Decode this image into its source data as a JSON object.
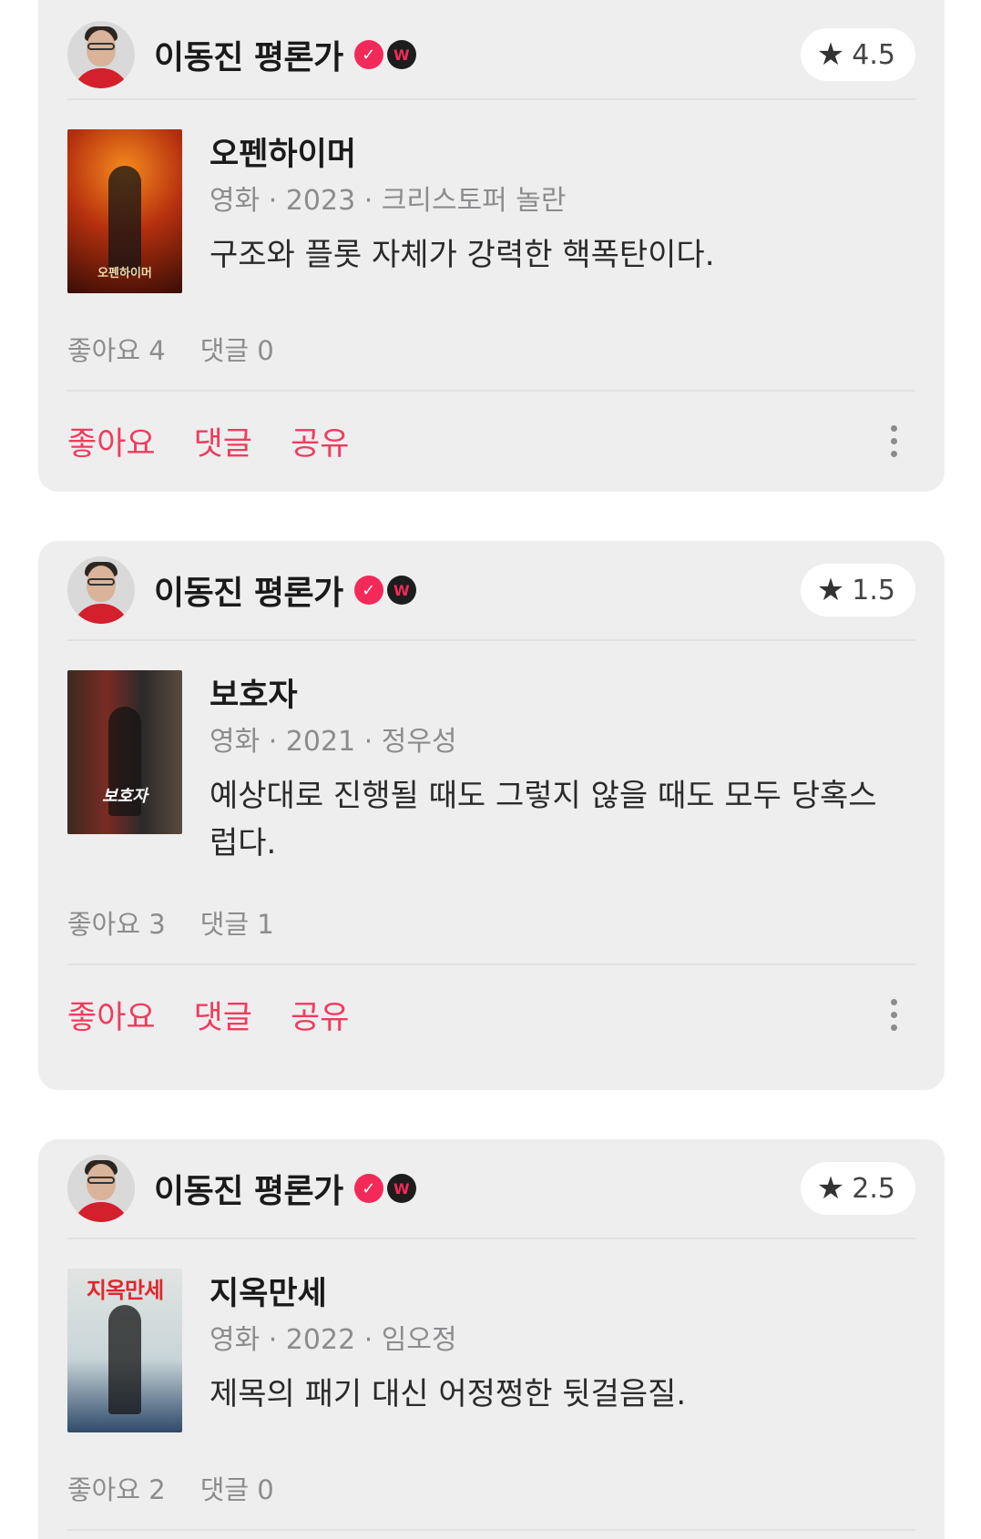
{
  "reviews": [
    {
      "critic": "이동진 평론가",
      "rating": "4.5",
      "title": "오펜하이머",
      "meta": "영화 · 2023 · 크리스토퍼 놀란",
      "comment": "구조와 플롯 자체가 강력한 핵폭탄이다.",
      "likes": "좋아요 4",
      "comments": "댓글 0",
      "poster_text": "오펜하이머"
    },
    {
      "critic": "이동진 평론가",
      "rating": "1.5",
      "title": "보호자",
      "meta": "영화 · 2021 · 정우성",
      "comment": "예상대로 진행될 때도 그렇지 않을 때도 모두 당혹스럽다.",
      "likes": "좋아요 3",
      "comments": "댓글 1",
      "poster_text": "보호자"
    },
    {
      "critic": "이동진 평론가",
      "rating": "2.5",
      "title": "지옥만세",
      "meta": "영화 · 2022 · 임오정",
      "comment": "제목의 패기 대신 어정쩡한 뒷걸음질.",
      "likes": "좋아요 2",
      "comments": "댓글 0",
      "poster_text": "지옥만세"
    }
  ],
  "actions": {
    "like": "좋아요",
    "comment": "댓글",
    "share": "공유"
  },
  "icons": {
    "star": "star-icon",
    "verified": "verified-badge-icon",
    "watcha": "watcha-badge-icon",
    "more": "more-vertical-icon"
  },
  "colors": {
    "accent": "#f03c5c",
    "card_bg": "#eeeeef",
    "muted_text": "#8c8c8e"
  }
}
